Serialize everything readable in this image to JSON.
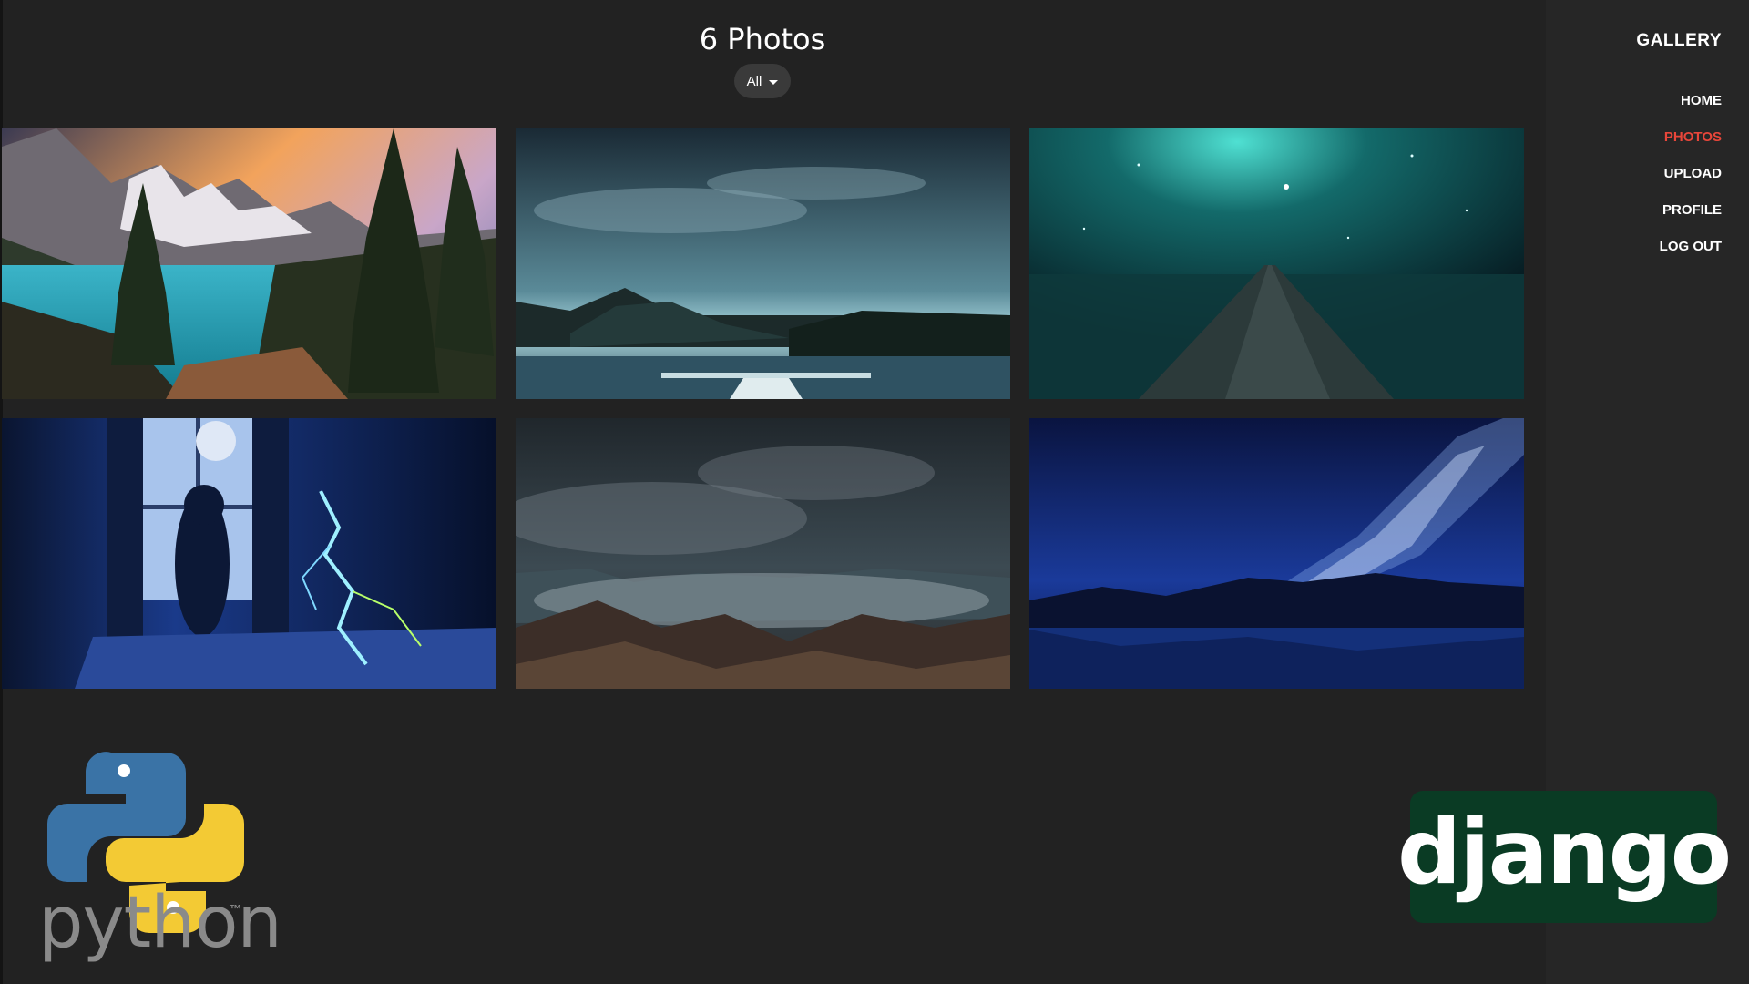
{
  "header": {
    "title": "6 Photos",
    "filter_label": "All"
  },
  "sidebar": {
    "brand": "GALLERY",
    "items": [
      {
        "label": "HOME",
        "active": false
      },
      {
        "label": "PHOTOS",
        "active": true
      },
      {
        "label": "UPLOAD",
        "active": false
      },
      {
        "label": "PROFILE",
        "active": false
      },
      {
        "label": "LOG OUT",
        "active": false
      }
    ]
  },
  "photos": [
    {
      "scene": "mountain-lake-sunset"
    },
    {
      "scene": "night-lake-dock"
    },
    {
      "scene": "teal-pier-stars"
    },
    {
      "scene": "woman-window-lightning"
    },
    {
      "scene": "clouds-mountains-night"
    },
    {
      "scene": "milky-way-lake"
    }
  ],
  "logos": {
    "python_text": "python",
    "python_tm": "™",
    "django_text": "django"
  },
  "colors": {
    "background": "#222222",
    "sidebar": "#262626",
    "active_nav": "#e8463a",
    "django_green": "#0a3b24"
  }
}
